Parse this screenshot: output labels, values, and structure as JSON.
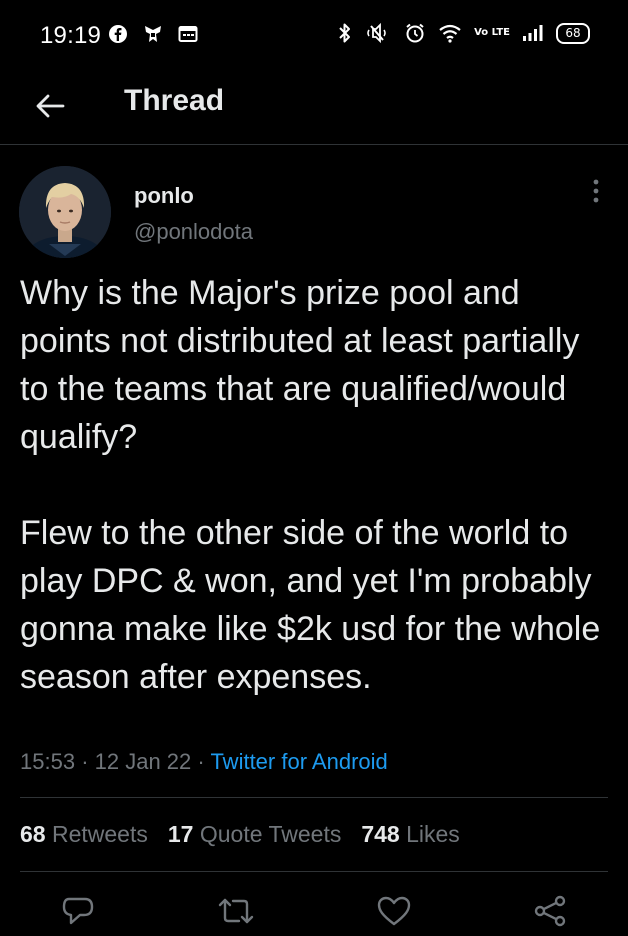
{
  "status_bar": {
    "time": "19:19",
    "battery": "68",
    "network_label": "Vo LTE"
  },
  "header": {
    "title": "Thread",
    "back_icon": "arrow-left-icon"
  },
  "tweet": {
    "author_name": "ponlo",
    "author_handle": "@ponlodota",
    "text": "Why is the Major's prize pool and points not distributed at least partially to the teams that are qualified/would qualify?\n\nFlew to the other side of the world to play DPC & won, and yet I'm probably gonna make like $2k usd for the whole season after expenses.",
    "time": "15:53",
    "date": "12 Jan 22",
    "separator": "·",
    "client": "Twitter for Android"
  },
  "stats": {
    "retweets_count": "68",
    "retweets_label": "Retweets",
    "quotes_count": "17",
    "quotes_label": "Quote Tweets",
    "likes_count": "748",
    "likes_label": "Likes"
  },
  "colors": {
    "background": "#000000",
    "text": "#e7e9ea",
    "secondary": "#71767b",
    "accent": "#1d9bf0",
    "divider": "#2f3336"
  }
}
